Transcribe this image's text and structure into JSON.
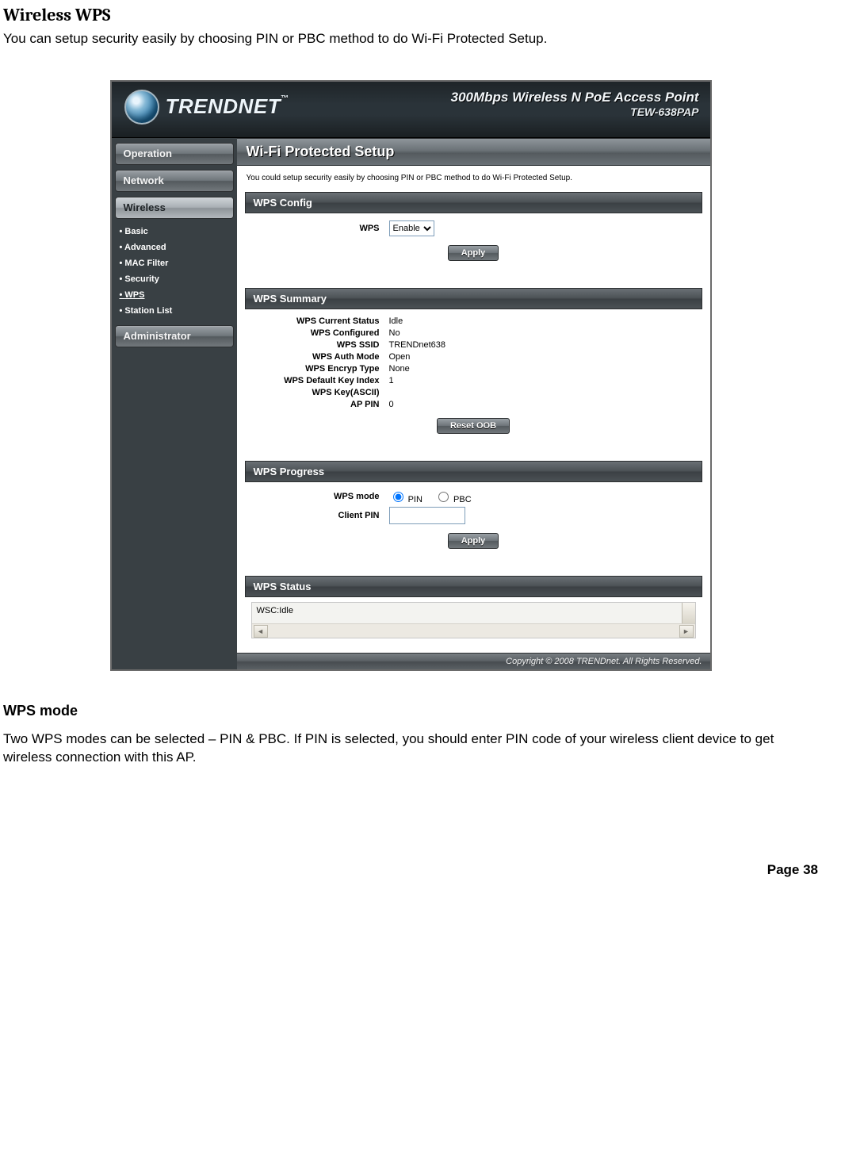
{
  "doc": {
    "heading": "Wireless WPS",
    "intro": "You can setup security easily by choosing PIN or PBC method to do Wi-Fi Protected Setup.",
    "sub_heading": "WPS mode",
    "sub_text": "Two WPS modes can be selected – PIN & PBC. If PIN is selected, you should enter PIN code of your wireless client device to get wireless connection with this AP.",
    "page_number": "Page  38"
  },
  "header": {
    "brand": "TRENDNET",
    "product_title": "300Mbps Wireless N PoE Access Point",
    "model": "TEW-638PAP"
  },
  "nav": {
    "operation": "Operation",
    "network": "Network",
    "wireless": "Wireless",
    "administrator": "Administrator",
    "wireless_items": {
      "basic": "Basic",
      "advanced": "Advanced",
      "mac_filter": "MAC Filter",
      "security": "Security",
      "wps": "WPS",
      "station_list": "Station List"
    }
  },
  "content": {
    "page_title": "Wi-Fi Protected Setup",
    "intro_small": "You could setup security easily by choosing PIN or PBC method to do Wi-Fi Protected Setup.",
    "config": {
      "title": "WPS Config",
      "label_wps": "WPS",
      "select_value": "Enable",
      "apply": "Apply"
    },
    "summary": {
      "title": "WPS Summary",
      "rows": {
        "current_status": {
          "label": "WPS Current Status",
          "value": "Idle"
        },
        "configured": {
          "label": "WPS Configured",
          "value": "No"
        },
        "ssid": {
          "label": "WPS SSID",
          "value": "TRENDnet638"
        },
        "auth_mode": {
          "label": "WPS Auth Mode",
          "value": "Open"
        },
        "encryp_type": {
          "label": "WPS Encryp Type",
          "value": "None"
        },
        "def_key_idx": {
          "label": "WPS Default Key Index",
          "value": "1"
        },
        "key_ascii": {
          "label": "WPS Key(ASCII)",
          "value": ""
        },
        "ap_pin": {
          "label": "AP PIN",
          "value": "0"
        }
      },
      "reset_btn": "Reset OOB"
    },
    "progress": {
      "title": "WPS Progress",
      "mode_label": "WPS mode",
      "pin_label": "PIN",
      "pbc_label": "PBC",
      "client_pin_label": "Client PIN",
      "client_pin_value": "",
      "apply": "Apply"
    },
    "status": {
      "title": "WPS Status",
      "text": "WSC:Idle"
    },
    "footer": "Copyright © 2008 TRENDnet. All Rights Reserved."
  }
}
